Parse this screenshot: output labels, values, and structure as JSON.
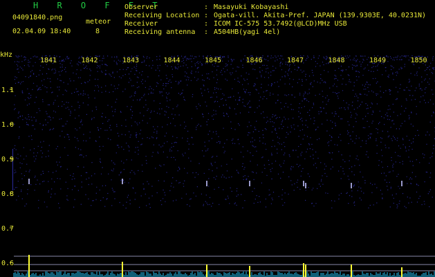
{
  "header": {
    "app_title": "H R O F F T",
    "filename": "04091840.png",
    "datetime": "02.04.09 18:40",
    "meteor_label": "meteor",
    "meteor_count": "8"
  },
  "station_info": [
    {
      "key": "Observer",
      "value": "Masayuki Kobayashi"
    },
    {
      "key": "Receiving Location",
      "value": "Ogata-vill. Akita-Pref. JAPAN (139.9303E, 40.0231N)"
    },
    {
      "key": "Receiver",
      "value": "ICOM IC-575 53.7492(@LCD)MHz USB"
    },
    {
      "key": "Receiving antenna",
      "value": "A504HB(yagi 4el)"
    }
  ],
  "spectrogram": {
    "y_unit": "kHz",
    "time_ticks": [
      "1841",
      "1842",
      "1843",
      "1844",
      "1845",
      "1846",
      "1847",
      "1848",
      "1849",
      "1850"
    ],
    "freq_ticks": [
      "1.1",
      "1.0",
      "0.9",
      "0.8",
      "0.7",
      "0.6"
    ],
    "colors": {
      "background": "#000000",
      "noise": "#2a2aa0",
      "axis_text": "#e8e838",
      "grid": "#8888aa",
      "power_trace": "#22bbee",
      "meteor_spike": "#ffff33"
    }
  }
}
